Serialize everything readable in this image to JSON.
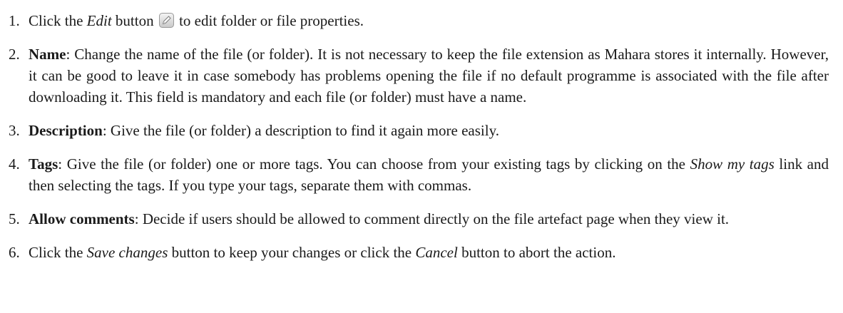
{
  "steps": [
    {
      "num": "1.",
      "pre": "Click the ",
      "em1": "Edit",
      "mid": " button ",
      "icon": "edit-pencil-icon",
      "post": " to edit folder or file properties."
    },
    {
      "num": "2.",
      "term": "Name",
      "text": ": Change the name of the file (or folder). It is not necessary to keep the file extension as Mahara stores it internally. However, it can be good to leave it in case somebody has problems opening the file if no default programme is associated with the file after downloading it. This field is mandatory and each file (or folder) must have a name."
    },
    {
      "num": "3.",
      "term": "Description",
      "text": ": Give the file (or folder) a description to find it again more easily."
    },
    {
      "num": "4.",
      "term": "Tags",
      "text1": ": Give the file (or folder) one or more tags. You can choose from your existing tags by clicking on the ",
      "em": "Show my tags",
      "text2": " link and then selecting the tags. If you type your tags, separate them with commas."
    },
    {
      "num": "5.",
      "term": "Allow comments",
      "text": ": Decide if users should be allowed to comment directly on the file artefact page when they view it."
    },
    {
      "num": "6.",
      "pre": "Click the ",
      "em1": "Save changes",
      "mid": " button to keep your changes or click the ",
      "em2": "Cancel",
      "post": " button to abort the action."
    }
  ]
}
